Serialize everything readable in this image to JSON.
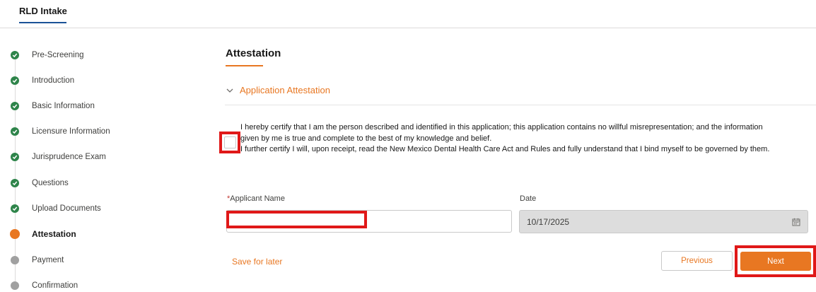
{
  "app": {
    "tab_label": "RLD Intake",
    "accent_color": "#e87722",
    "highlight_color": "#e01818"
  },
  "steps": [
    {
      "label": "Pre-Screening",
      "status": "done"
    },
    {
      "label": "Introduction",
      "status": "done"
    },
    {
      "label": "Basic Information",
      "status": "done"
    },
    {
      "label": "Licensure Information",
      "status": "done"
    },
    {
      "label": "Jurisprudence Exam",
      "status": "done"
    },
    {
      "label": "Questions",
      "status": "done"
    },
    {
      "label": "Upload Documents",
      "status": "done"
    },
    {
      "label": "Attestation",
      "status": "current"
    },
    {
      "label": "Payment",
      "status": "todo"
    },
    {
      "label": "Confirmation",
      "status": "todo"
    }
  ],
  "main": {
    "section_title": "Attestation",
    "accordion_label": "Application Attestation",
    "attestation_line_1": "I hereby certify that I am the person described and identified in this application; this application contains no willful misrepresentation; and the information given by me is true and complete to the best of my knowledge and belief.",
    "attestation_line_2": "I further certify I will, upon receipt, read the New Mexico Dental Health Care Act and Rules and fully understand that I bind myself to be governed by them.",
    "attestation_checked": false,
    "applicant_name_label": "Applicant Name",
    "required_marker": "*",
    "applicant_name_value": "",
    "date_label": "Date",
    "date_value": "10/17/2025"
  },
  "footer": {
    "save_for_later": "Save for later",
    "previous_label": "Previous",
    "next_label": "Next"
  }
}
